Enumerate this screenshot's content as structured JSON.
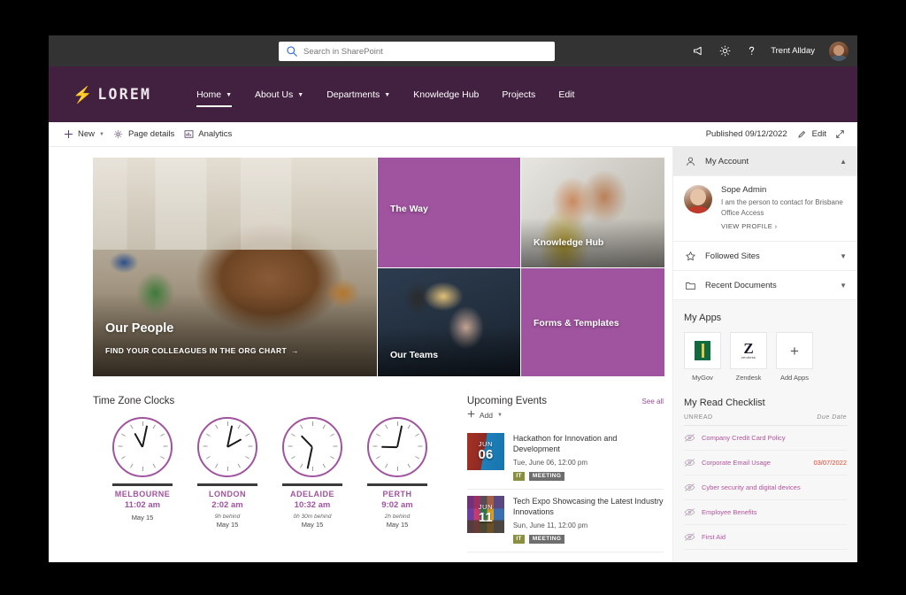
{
  "suite": {
    "search_placeholder": "Search in SharePoint",
    "search_value": "",
    "search_icon": "search-icon",
    "icons": [
      {
        "name": "megaphone-icon",
        "label": "Announcements"
      },
      {
        "name": "gear-icon",
        "label": "Settings"
      },
      {
        "name": "help-icon",
        "label": "Help"
      }
    ],
    "user_name": "Trent Allday",
    "avatar": "user-avatar"
  },
  "site_nav": {
    "brand": "LOREM",
    "brand_icon": "bolt-icon",
    "links": [
      {
        "label": "Home",
        "has_chevron": true,
        "selected": true
      },
      {
        "label": "About Us",
        "has_chevron": true,
        "selected": false
      },
      {
        "label": "Departments",
        "has_chevron": true,
        "selected": false
      },
      {
        "label": "Knowledge Hub",
        "has_chevron": false,
        "selected": false
      },
      {
        "label": "Projects",
        "has_chevron": false,
        "selected": false
      },
      {
        "label": "Edit",
        "has_chevron": false,
        "selected": false
      }
    ]
  },
  "command_bar": {
    "new_label": "New",
    "page_details_label": "Page details",
    "analytics_label": "Analytics",
    "published_label": "Published 09/12/2022",
    "edit_label": "Edit",
    "expand_icon": "expand-icon"
  },
  "hero": {
    "tiles": [
      {
        "id": "our-people",
        "label": "Our People",
        "cta": "FIND YOUR COLLEAGUES IN THE ORG CHART",
        "cta_arrow": "arrow-right-icon",
        "kind": "photo"
      },
      {
        "id": "the-way",
        "label": "The Way",
        "kind": "color"
      },
      {
        "id": "our-teams",
        "label": "Our Teams",
        "kind": "photo"
      },
      {
        "id": "knowledge-hub",
        "label": "Knowledge Hub",
        "kind": "photo"
      },
      {
        "id": "forms-templates",
        "label": "Forms & Templates",
        "kind": "color"
      }
    ]
  },
  "clocks": {
    "title": "Time Zone Clocks",
    "items": [
      {
        "city": "MELBOURNE",
        "time": "11:02 am",
        "offset": "",
        "date": "May 15",
        "hour_deg": 331,
        "minute_deg": 12
      },
      {
        "city": "LONDON",
        "time": "2:02 am",
        "offset": "9h behind",
        "date": "May 15",
        "hour_deg": 61,
        "minute_deg": 12
      },
      {
        "city": "ADELAIDE",
        "time": "10:32 am",
        "offset": "0h 30m behind",
        "date": "May 15",
        "hour_deg": 316,
        "minute_deg": 192
      },
      {
        "city": "PERTH",
        "time": "9:02 am",
        "offset": "2h behind",
        "date": "May 15",
        "hour_deg": 271,
        "minute_deg": 12
      }
    ]
  },
  "events": {
    "title": "Upcoming Events",
    "see_all": "See all",
    "add_label": "Add",
    "items": [
      {
        "month": "JUN",
        "day": "06",
        "title": "Hackathon for Innovation and Development",
        "when": "Tue, June 06, 12:00 pm",
        "tags": [
          "IT",
          "MEETING"
        ]
      },
      {
        "month": "JUN",
        "day": "11",
        "title": "Tech Expo Showcasing the Latest Industry Innovations",
        "when": "Sun, June 11, 12:00 pm",
        "tags": [
          "IT",
          "MEETING"
        ]
      }
    ]
  },
  "rail": {
    "my_account": {
      "label": "My Account",
      "icon": "person-icon",
      "chevron": "chevron-up-icon",
      "expanded": true,
      "profile": {
        "name": "Sope Admin",
        "description": "I am the person to contact for Brisbane Office Access",
        "view_profile": "VIEW PROFILE",
        "view_profile_arrow": "chevron-right-icon",
        "avatar": "profile-avatar"
      }
    },
    "followed_sites": {
      "label": "Followed Sites",
      "icon": "star-icon",
      "chevron": "chevron-down-icon"
    },
    "recent_documents": {
      "label": "Recent Documents",
      "icon": "folder-icon",
      "chevron": "chevron-down-icon"
    },
    "my_apps": {
      "title": "My Apps",
      "items": [
        {
          "name": "MyGov",
          "icon": "mygov-icon"
        },
        {
          "name": "Zendesk",
          "icon": "zendesk-icon"
        },
        {
          "name": "Add Apps",
          "icon": "plus-icon"
        }
      ]
    },
    "checklist": {
      "title": "My Read Checklist",
      "col_unread": "UNREAD",
      "col_due": "Due Date",
      "items": [
        {
          "name": "Company Credit Card Policy",
          "due": "",
          "icon": "eye-off-icon"
        },
        {
          "name": "Corporate Email Usage",
          "due": "03/07/2022",
          "icon": "eye-off-icon"
        },
        {
          "name": "Cyber security and digital devices",
          "due": "",
          "icon": "eye-off-icon"
        },
        {
          "name": "Employee Benefits",
          "due": "",
          "icon": "eye-off-icon"
        },
        {
          "name": "First Aid",
          "due": "",
          "icon": "eye-off-icon"
        }
      ]
    }
  },
  "colors": {
    "brand_purple": "#422140",
    "accent_purple": "#A0539F",
    "link_purple": "#b3539f",
    "due_red": "#e8412b",
    "suite_bar": "#333333"
  }
}
